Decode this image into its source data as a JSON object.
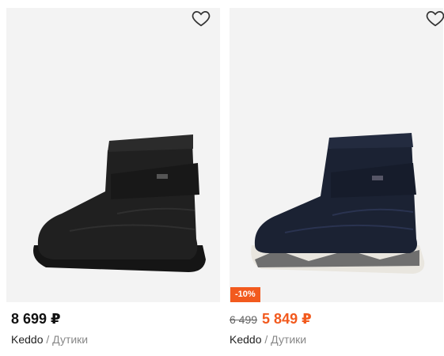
{
  "products": [
    {
      "price": "8 699 ₽",
      "brand": "Keddo",
      "separator": " / ",
      "category": "Дутики",
      "image": "black-moon-boot",
      "favorite_icon": "heart-outline-icon"
    },
    {
      "discount_badge": "-10%",
      "old_price": "6 499",
      "price": "5 849 ₽",
      "brand": "Keddo",
      "separator": " / ",
      "category": "Дутики",
      "image": "navy-moon-boot",
      "favorite_icon": "heart-outline-icon",
      "accent_color": "#f25a1e"
    }
  ]
}
